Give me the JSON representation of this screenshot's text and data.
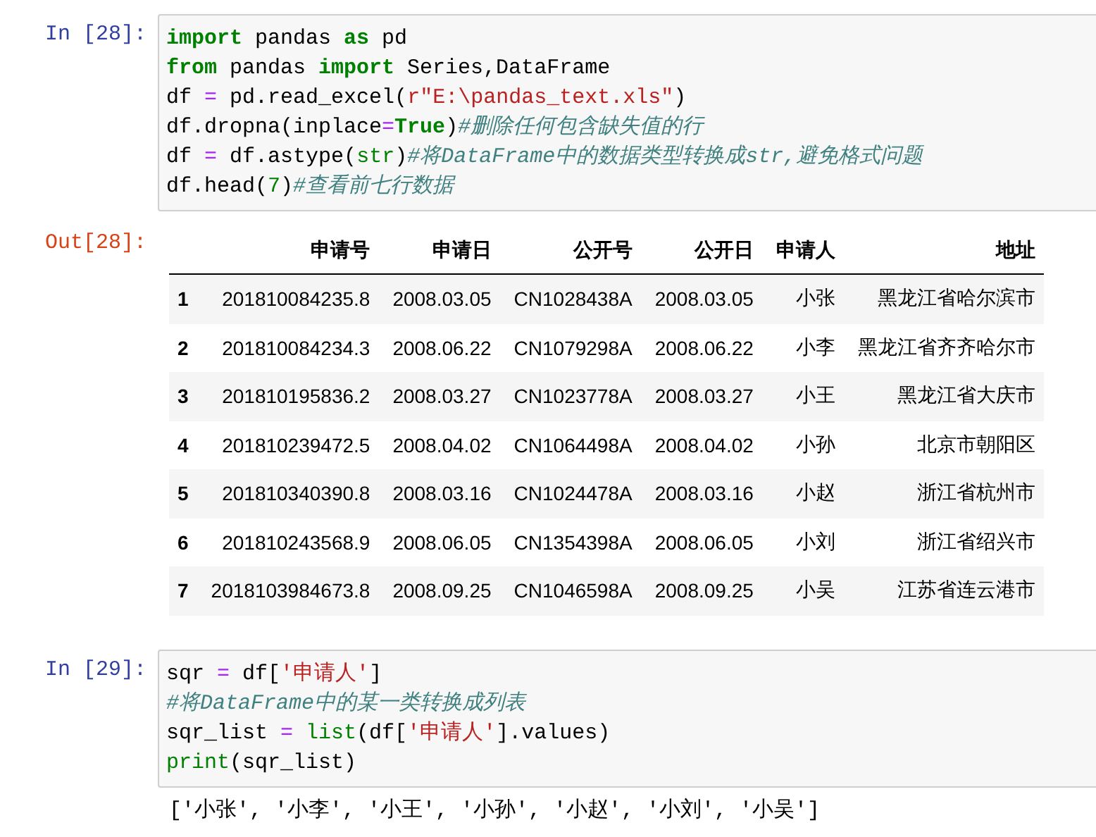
{
  "cells": [
    {
      "kind": "code",
      "prompt": "In [28]:",
      "lines": [
        [
          {
            "kind": "kw",
            "text": "import"
          },
          {
            "kind": "plain",
            "text": " pandas "
          },
          {
            "kind": "kw",
            "text": "as"
          },
          {
            "kind": "plain",
            "text": " pd"
          }
        ],
        [
          {
            "kind": "kw",
            "text": "from"
          },
          {
            "kind": "plain",
            "text": " pandas "
          },
          {
            "kind": "kw",
            "text": "import"
          },
          {
            "kind": "plain",
            "text": " Series,DataFrame"
          }
        ],
        [
          {
            "kind": "plain",
            "text": "df "
          },
          {
            "kind": "op",
            "text": "="
          },
          {
            "kind": "plain",
            "text": " pd.read_excel("
          },
          {
            "kind": "str",
            "text": "r\"E:\\pandas_text.xls\""
          },
          {
            "kind": "plain",
            "text": ")"
          }
        ],
        [
          {
            "kind": "plain",
            "text": "df.dropna(inplace"
          },
          {
            "kind": "op",
            "text": "="
          },
          {
            "kind": "kw",
            "text": "True"
          },
          {
            "kind": "plain",
            "text": ")"
          },
          {
            "kind": "comment",
            "text": "#删除任何包含缺失值的行"
          }
        ],
        [
          {
            "kind": "plain",
            "text": "df "
          },
          {
            "kind": "op",
            "text": "="
          },
          {
            "kind": "plain",
            "text": " df.astype("
          },
          {
            "kind": "builtin",
            "text": "str"
          },
          {
            "kind": "plain",
            "text": ")"
          },
          {
            "kind": "comment",
            "text": "#将DataFrame中的数据类型转换成str,避免格式问题"
          }
        ],
        [
          {
            "kind": "plain",
            "text": "df.head("
          },
          {
            "kind": "builtin",
            "text": "7"
          },
          {
            "kind": "plain",
            "text": ")"
          },
          {
            "kind": "comment",
            "text": "#查看前七行数据"
          }
        ]
      ]
    },
    {
      "kind": "table",
      "prompt": "Out[28]:",
      "columns": [
        "申请号",
        "申请日",
        "公开号",
        "公开日",
        "申请人",
        "地址"
      ],
      "rows": [
        {
          "index": "1",
          "cells": [
            "201810084235.8",
            "2008.03.05",
            "CN1028438A",
            "2008.03.05",
            "小张",
            "黑龙江省哈尔滨市"
          ]
        },
        {
          "index": "2",
          "cells": [
            "201810084234.3",
            "2008.06.22",
            "CN1079298A",
            "2008.06.22",
            "小李",
            "黑龙江省齐齐哈尔市"
          ]
        },
        {
          "index": "3",
          "cells": [
            "201810195836.2",
            "2008.03.27",
            "CN1023778A",
            "2008.03.27",
            "小王",
            "黑龙江省大庆市"
          ]
        },
        {
          "index": "4",
          "cells": [
            "201810239472.5",
            "2008.04.02",
            "CN1064498A",
            "2008.04.02",
            "小孙",
            "北京市朝阳区"
          ]
        },
        {
          "index": "5",
          "cells": [
            "201810340390.8",
            "2008.03.16",
            "CN1024478A",
            "2008.03.16",
            "小赵",
            "浙江省杭州市"
          ]
        },
        {
          "index": "6",
          "cells": [
            "201810243568.9",
            "2008.06.05",
            "CN1354398A",
            "2008.06.05",
            "小刘",
            "浙江省绍兴市"
          ]
        },
        {
          "index": "7",
          "cells": [
            "2018103984673.8",
            "2008.09.25",
            "CN1046598A",
            "2008.09.25",
            "小吴",
            "江苏省连云港市"
          ]
        }
      ]
    },
    {
      "kind": "code",
      "prompt": "In [29]:",
      "lines": [
        [
          {
            "kind": "plain",
            "text": "sqr "
          },
          {
            "kind": "op",
            "text": "="
          },
          {
            "kind": "plain",
            "text": " df["
          },
          {
            "kind": "str",
            "text": "'申请人'"
          },
          {
            "kind": "plain",
            "text": "]"
          }
        ],
        [
          {
            "kind": "comment",
            "text": "#将DataFrame中的某一类转换成列表"
          }
        ],
        [
          {
            "kind": "plain",
            "text": "sqr_list "
          },
          {
            "kind": "op",
            "text": "="
          },
          {
            "kind": "builtin",
            "text": " list"
          },
          {
            "kind": "plain",
            "text": "(df["
          },
          {
            "kind": "str",
            "text": "'申请人'"
          },
          {
            "kind": "plain",
            "text": "].values)"
          }
        ],
        [
          {
            "kind": "builtin",
            "text": "print"
          },
          {
            "kind": "plain",
            "text": "(sqr_list)"
          }
        ]
      ]
    },
    {
      "kind": "stream",
      "text": "['小张', '小李', '小王', '小孙', '小赵', '小刘', '小吴']"
    }
  ]
}
